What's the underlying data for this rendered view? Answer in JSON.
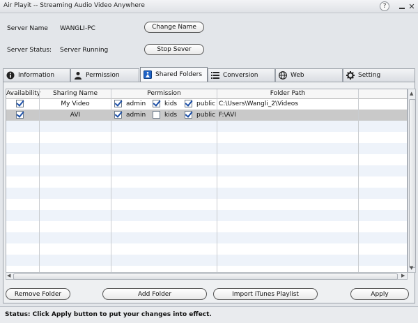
{
  "window": {
    "title": "Air Playit -- Streaming Audio Video Anywhere",
    "help_glyph": "?",
    "close_glyph": "✕"
  },
  "server": {
    "name_label": "Server Name",
    "name_value": "WANGLI-PC",
    "change_name_button": "Change Name",
    "status_label": "Server Status:",
    "status_value": "Server Running",
    "stop_button": "Stop Sever"
  },
  "tabs": [
    {
      "label": "Information",
      "icon": "info-icon",
      "active": false
    },
    {
      "label": "Permission",
      "icon": "person-icon",
      "active": false
    },
    {
      "label": "Shared Folders",
      "icon": "folder-share-icon",
      "active": true
    },
    {
      "label": "Conversion",
      "icon": "list-icon",
      "active": false
    },
    {
      "label": "Web",
      "icon": "globe-icon",
      "active": false
    },
    {
      "label": "Setting",
      "icon": "gear-icon",
      "active": false
    }
  ],
  "table": {
    "headers": {
      "availability": "Availability",
      "sharing_name": "Sharing Name",
      "permission": "Permission",
      "folder_path": "Folder Path"
    },
    "permission_labels": {
      "admin": "admin",
      "kids": "kids",
      "public": "public"
    },
    "rows": [
      {
        "available": true,
        "name": "My Video",
        "admin": true,
        "kids": true,
        "public": true,
        "path": "C:\\Users\\Wangli_2\\Videos",
        "selected": false
      },
      {
        "available": true,
        "name": "AVI",
        "admin": true,
        "kids": false,
        "public": true,
        "path": "F:\\AVI",
        "selected": true
      }
    ]
  },
  "buttons": {
    "remove_folder": "Remove Folder",
    "add_folder": "Add Folder",
    "import_itunes": "Import iTunes Playlist",
    "apply": "Apply"
  },
  "status_bar": {
    "text": "Status:  Click Apply button to put your changes into effect."
  }
}
